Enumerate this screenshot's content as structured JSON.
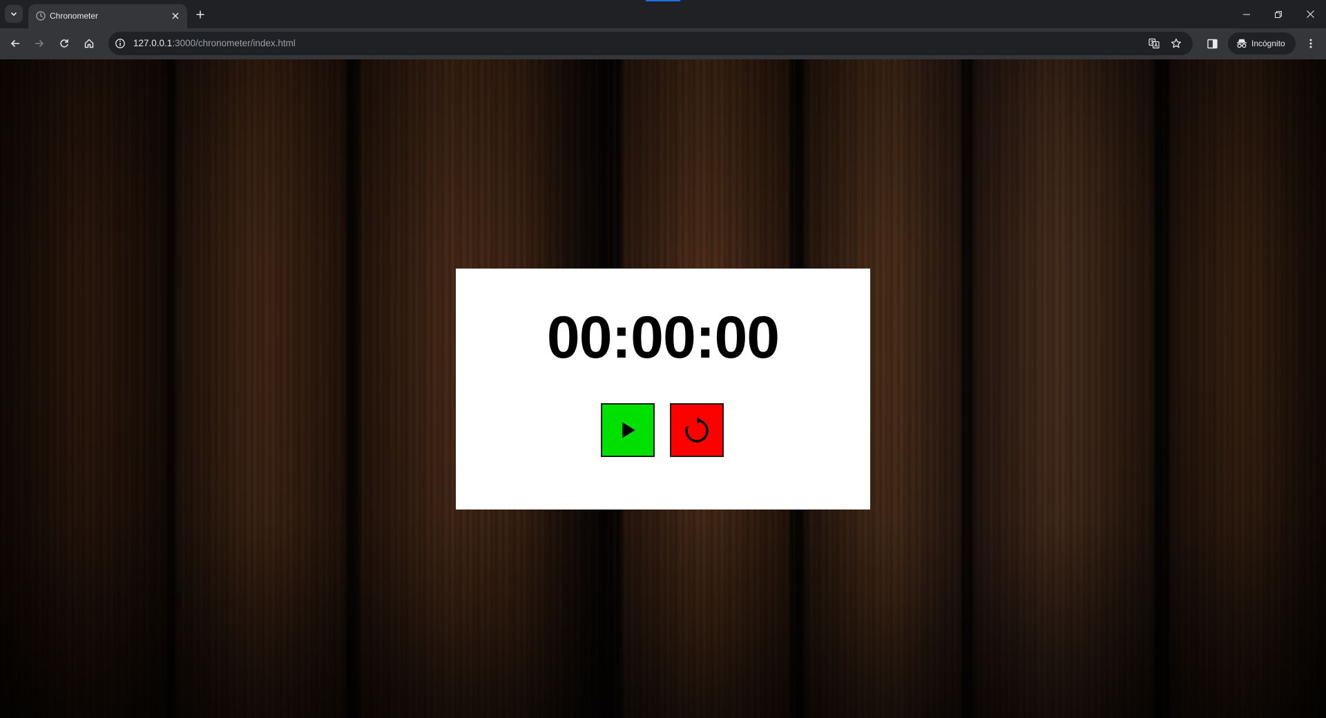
{
  "browser": {
    "tab_title": "Chronometer",
    "url_host": "127.0.0.1",
    "url_rest": ":3000/chronometer/index.html",
    "profile_label": "Incógnito"
  },
  "chronometer": {
    "time": "00:00:00",
    "play_icon": "play-icon",
    "reset_icon": "reset-icon",
    "colors": {
      "play": "#00e000",
      "reset": "#ff0000",
      "card": "#ffffff"
    }
  }
}
